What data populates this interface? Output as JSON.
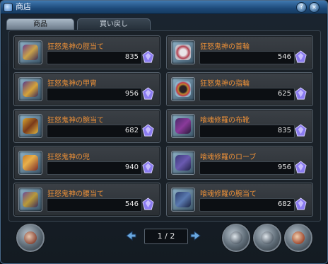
{
  "window": {
    "title": "商店",
    "help_label": "?",
    "close_label": "✕"
  },
  "tabs": [
    {
      "label": "商品",
      "active": true
    },
    {
      "label": "買い戻し",
      "active": false
    }
  ],
  "items": [
    {
      "name": "狂怒鬼神の脛当て",
      "price": "835",
      "icon": "greaves-icon"
    },
    {
      "name": "狂怒鬼神の首輪",
      "price": "546",
      "icon": "necklace-icon"
    },
    {
      "name": "狂怒鬼神の甲冑",
      "price": "956",
      "icon": "armor-icon"
    },
    {
      "name": "狂怒鬼神の指輪",
      "price": "625",
      "icon": "ring-icon"
    },
    {
      "name": "狂怒鬼神の腕当て",
      "price": "682",
      "icon": "bracer-icon"
    },
    {
      "name": "喰魂修羅の布靴",
      "price": "835",
      "icon": "boots-icon"
    },
    {
      "name": "狂怒鬼神の兜",
      "price": "940",
      "icon": "helmet-icon"
    },
    {
      "name": "喰魂修羅のローブ",
      "price": "956",
      "icon": "robe-icon"
    },
    {
      "name": "狂怒鬼神の腰当て",
      "price": "546",
      "icon": "belt-icon"
    },
    {
      "name": "喰魂修羅の腕当て",
      "price": "682",
      "icon": "bracer-icon"
    }
  ],
  "pagination": {
    "text": "1 / 2"
  },
  "colors": {
    "item_name": "#ea8f38",
    "gem": "#8b7cf0",
    "titlebar": "#2a5f95"
  }
}
